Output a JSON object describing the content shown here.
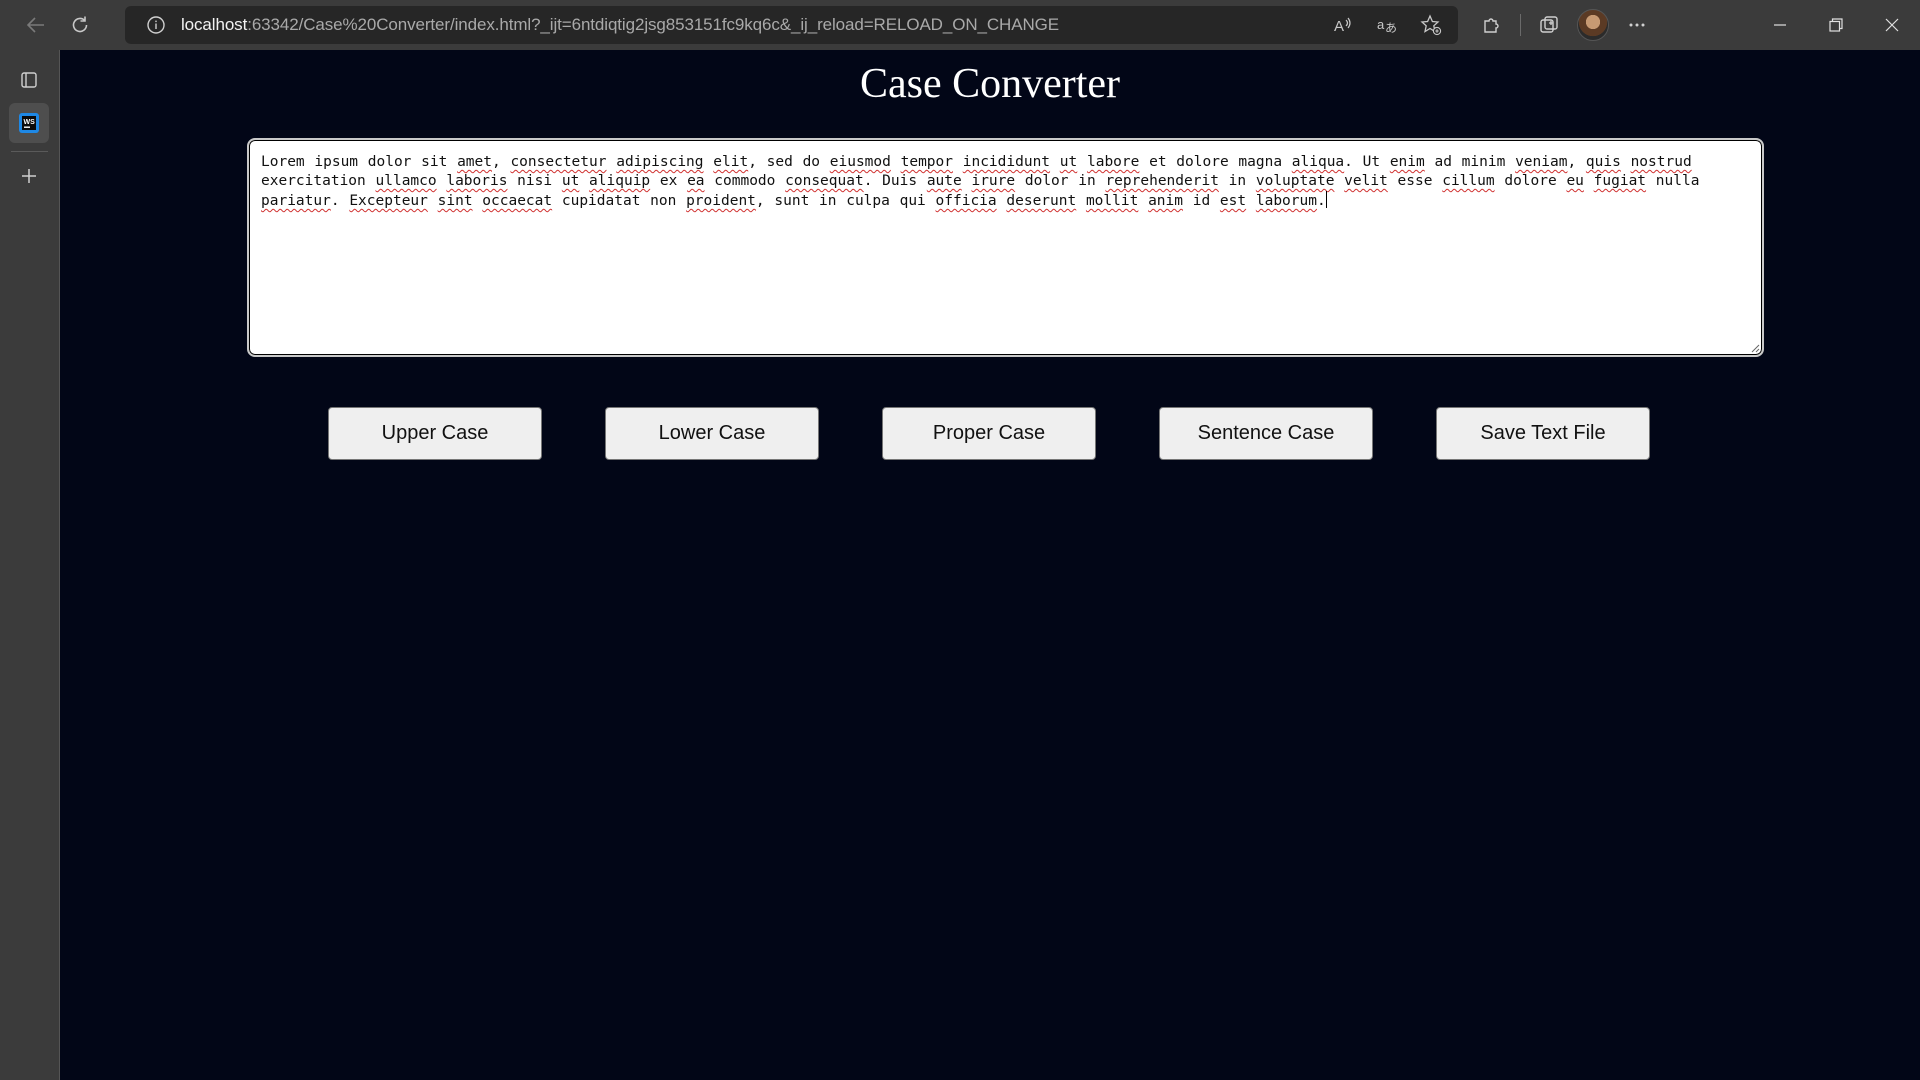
{
  "browser": {
    "url_host": "localhost",
    "url_rest": ":63342/Case%20Converter/index.html?_ijt=6ntdiqtig2jsg853151fc9kq6c&_ij_reload=RELOAD_ON_CHANGE"
  },
  "page": {
    "title": "Case Converter",
    "textarea": {
      "segments": [
        {
          "t": "Lorem ipsum dolor sit ",
          "s": false
        },
        {
          "t": "amet",
          "s": true
        },
        {
          "t": ", ",
          "s": false
        },
        {
          "t": "consectetur",
          "s": true
        },
        {
          "t": " ",
          "s": false
        },
        {
          "t": "adipiscing",
          "s": true
        },
        {
          "t": " ",
          "s": false
        },
        {
          "t": "elit",
          "s": true
        },
        {
          "t": ", sed do ",
          "s": false
        },
        {
          "t": "eiusmod",
          "s": true
        },
        {
          "t": " ",
          "s": false
        },
        {
          "t": "tempor",
          "s": true
        },
        {
          "t": " ",
          "s": false
        },
        {
          "t": "incididunt",
          "s": true
        },
        {
          "t": " ",
          "s": false
        },
        {
          "t": "ut",
          "s": true
        },
        {
          "t": " ",
          "s": false
        },
        {
          "t": "labore",
          "s": true
        },
        {
          "t": " et dolore magna ",
          "s": false
        },
        {
          "t": "aliqua",
          "s": true
        },
        {
          "t": ". Ut ",
          "s": false
        },
        {
          "t": "enim",
          "s": true
        },
        {
          "t": " ad minim ",
          "s": false
        },
        {
          "t": "veniam",
          "s": true
        },
        {
          "t": ", ",
          "s": false
        },
        {
          "t": "quis",
          "s": true
        },
        {
          "t": " ",
          "s": false
        },
        {
          "t": "nostrud",
          "s": true
        },
        {
          "t": " exercitation ",
          "s": false
        },
        {
          "t": "ullamco",
          "s": true
        },
        {
          "t": " ",
          "s": false
        },
        {
          "t": "laboris",
          "s": true
        },
        {
          "t": " nisi ",
          "s": false
        },
        {
          "t": "ut",
          "s": true
        },
        {
          "t": " ",
          "s": false
        },
        {
          "t": "aliquip",
          "s": true
        },
        {
          "t": " ex ",
          "s": false
        },
        {
          "t": "ea",
          "s": true
        },
        {
          "t": " commodo ",
          "s": false
        },
        {
          "t": "consequat",
          "s": true
        },
        {
          "t": ". Duis ",
          "s": false
        },
        {
          "t": "aute",
          "s": true
        },
        {
          "t": " ",
          "s": false
        },
        {
          "t": "irure",
          "s": true
        },
        {
          "t": " dolor in ",
          "s": false
        },
        {
          "t": "reprehenderit",
          "s": true
        },
        {
          "t": " in ",
          "s": false
        },
        {
          "t": "voluptate",
          "s": true
        },
        {
          "t": " ",
          "s": false
        },
        {
          "t": "velit",
          "s": true
        },
        {
          "t": " esse ",
          "s": false
        },
        {
          "t": "cillum",
          "s": true
        },
        {
          "t": " dolore ",
          "s": false
        },
        {
          "t": "eu",
          "s": true
        },
        {
          "t": " ",
          "s": false
        },
        {
          "t": "fugiat",
          "s": true
        },
        {
          "t": " nulla ",
          "s": false
        },
        {
          "t": "pariatur",
          "s": true
        },
        {
          "t": ". ",
          "s": false
        },
        {
          "t": "Excepteur",
          "s": true
        },
        {
          "t": " ",
          "s": false
        },
        {
          "t": "sint",
          "s": true
        },
        {
          "t": " ",
          "s": false
        },
        {
          "t": "occaecat",
          "s": true
        },
        {
          "t": " cupidatat non ",
          "s": false
        },
        {
          "t": "proident",
          "s": true
        },
        {
          "t": ", sunt in culpa qui ",
          "s": false
        },
        {
          "t": "officia",
          "s": true
        },
        {
          "t": " ",
          "s": false
        },
        {
          "t": "deserunt",
          "s": true
        },
        {
          "t": " ",
          "s": false
        },
        {
          "t": "mollit",
          "s": true
        },
        {
          "t": " ",
          "s": false
        },
        {
          "t": "anim",
          "s": true
        },
        {
          "t": " id ",
          "s": false
        },
        {
          "t": "est",
          "s": true
        },
        {
          "t": " ",
          "s": false
        },
        {
          "t": "laborum",
          "s": true
        },
        {
          "t": ".",
          "s": false
        }
      ]
    },
    "buttons": {
      "upper": "Upper Case",
      "lower": "Lower Case",
      "proper": "Proper Case",
      "sentence": "Sentence Case",
      "save": "Save Text File"
    }
  },
  "colors": {
    "page_background": "#020617",
    "chrome_background": "#3b3b3b",
    "button_background": "#efefef"
  }
}
